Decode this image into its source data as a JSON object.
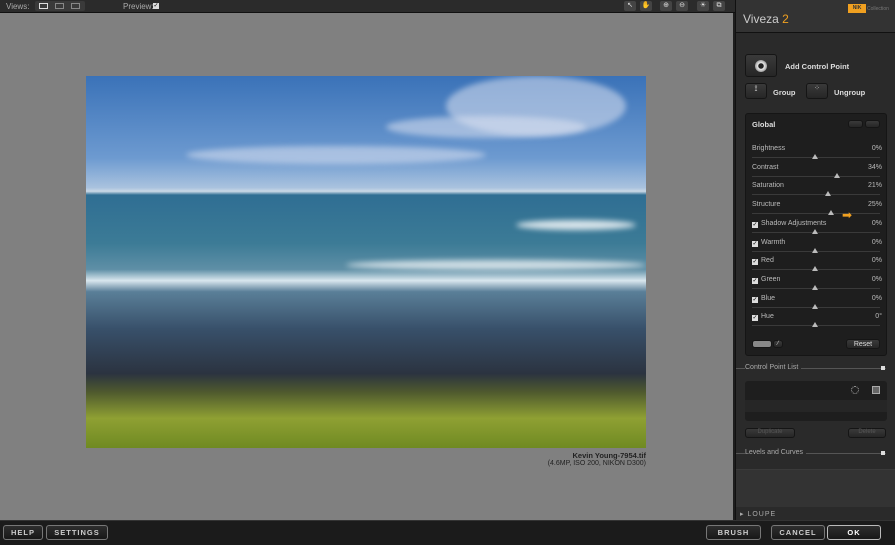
{
  "toolbar": {
    "views_label": "Views:",
    "preview_label": "Preview:",
    "preview_checked": "✓",
    "icons": [
      "hand-arrow-icon",
      "hand-icon",
      "zoom-in-icon",
      "zoom-out-icon",
      "light-icon",
      "compare-icon"
    ]
  },
  "image": {
    "filename": "Kevin Young-7954.tif",
    "info": "(4.6MP, ISO 200, NIKON D300)"
  },
  "panel": {
    "brand": "Viveza",
    "version": "2",
    "logo_text": "NIK",
    "collection": "Collection",
    "add_control_point": "Add Control Point",
    "group": "Group",
    "ungroup": "Ungroup",
    "global_title": "Global",
    "reset": "Reset",
    "sliders": [
      {
        "name": "Brightness",
        "value": "0%",
        "pct": 0,
        "check": false
      },
      {
        "name": "Contrast",
        "value": "34%",
        "pct": 34,
        "check": false
      },
      {
        "name": "Saturation",
        "value": "21%",
        "pct": 21,
        "check": false
      },
      {
        "name": "Structure",
        "value": "25%",
        "pct": 25,
        "check": false
      },
      {
        "name": "Shadow Adjustments",
        "value": "0%",
        "pct": 0,
        "check": true
      },
      {
        "name": "Warmth",
        "value": "0%",
        "pct": 0,
        "check": true
      },
      {
        "name": "Red",
        "value": "0%",
        "pct": 0,
        "check": true
      },
      {
        "name": "Green",
        "value": "0%",
        "pct": 0,
        "check": true
      },
      {
        "name": "Blue",
        "value": "0%",
        "pct": 0,
        "check": true
      },
      {
        "name": "Hue",
        "value": "0°",
        "pct": 0,
        "check": true
      }
    ],
    "control_point_list": "Control Point List",
    "duplicate": "Duplicate",
    "delete": "Delete",
    "levels_curves": "Levels and Curves",
    "loupe": "LOUPE"
  },
  "bottom": {
    "help": "HELP",
    "settings": "SETTINGS",
    "brush": "BRUSH",
    "cancel": "CANCEL",
    "ok": "OK"
  },
  "colors": {
    "accent": "#f0a020",
    "panel": "#2a2a2a",
    "canvas": "#808080"
  }
}
